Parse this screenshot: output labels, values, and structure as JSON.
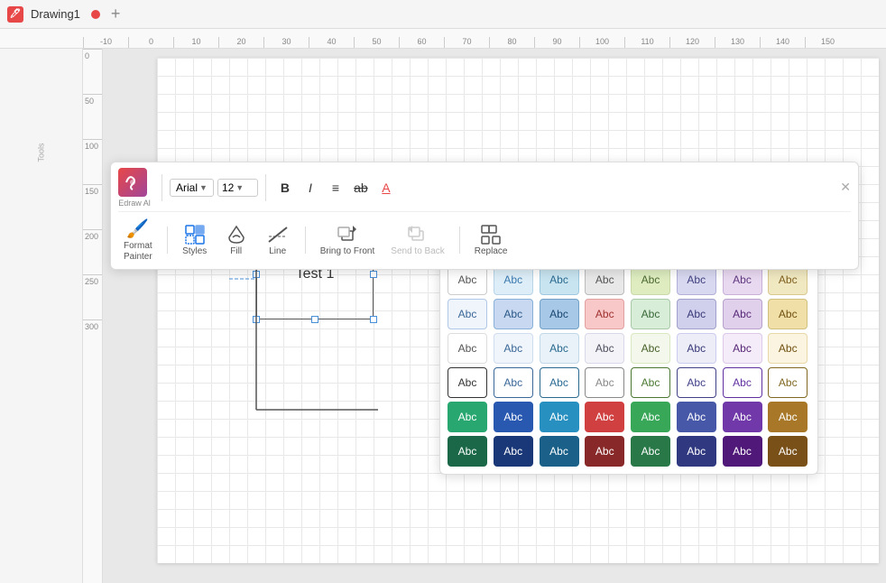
{
  "titleBar": {
    "appName": "Drawing1",
    "logoText": "🖊",
    "plusIcon": "+"
  },
  "toolbar": {
    "logoText": "n",
    "edrawLabel": "Edraw Al",
    "fontFamily": "Arial",
    "fontSize": "12",
    "boldLabel": "B",
    "italicLabel": "I",
    "alignLabel": "≡",
    "strikeLabel": "ab",
    "colorLabel": "A",
    "formatPainterLabel": "Format\nPainter",
    "stylesLabel": "Styles",
    "fillLabel": "Fill",
    "lineLabel": "Line",
    "bringFrontLabel": "Bring to Front",
    "sendBackLabel": "Send to Back",
    "replaceLabel": "Replace",
    "pinIcon": "✕"
  },
  "ruler": {
    "topMarks": [
      "-10",
      "0",
      "10",
      "20",
      "30",
      "40",
      "50",
      "60",
      "70",
      "80",
      "90",
      "100",
      "110",
      "120",
      "130",
      "140",
      "150"
    ],
    "leftMarks": [
      "0",
      "50",
      "100",
      "150",
      "200",
      "250",
      "300"
    ]
  },
  "canvas": {
    "shapeText": "Test 1"
  },
  "stylePanel": {
    "rows": [
      [
        {
          "text": "Abc",
          "bg": "",
          "border": "#ccc",
          "color": "#555"
        },
        {
          "text": "Abc",
          "bg": "#deeef8",
          "border": "#b8d4e8",
          "color": "#3a7ab0"
        },
        {
          "text": "Abc",
          "bg": "#c8e4f0",
          "border": "#9ec8e0",
          "color": "#2a6a90"
        },
        {
          "text": "Abc",
          "bg": "#e8e8e8",
          "border": "#bbb",
          "color": "#555"
        },
        {
          "text": "Abc",
          "bg": "#deecc0",
          "border": "#c8d8a8",
          "color": "#4a6830"
        },
        {
          "text": "Abc",
          "bg": "#d8d8f0",
          "border": "#b0b0d8",
          "color": "#404080"
        },
        {
          "text": "Abc",
          "bg": "#e8d8f0",
          "border": "#c8b0d8",
          "color": "#603880"
        },
        {
          "text": "Abc",
          "bg": "#f0e8c0",
          "border": "#d8c890",
          "color": "#806020"
        }
      ],
      [
        {
          "text": "Abc",
          "bg": "#f0f4fb",
          "border": "#b0c8e8",
          "color": "#3a6898"
        },
        {
          "text": "Abc",
          "bg": "#c8d8f0",
          "border": "#88b0d8",
          "color": "#2a5888"
        },
        {
          "text": "Abc",
          "bg": "#a8c8e8",
          "border": "#70a0c8",
          "color": "#1a4870"
        },
        {
          "text": "Abc",
          "bg": "#f8c8c8",
          "border": "#e0a0a0",
          "color": "#a03030"
        },
        {
          "text": "Abc",
          "bg": "#d8edd8",
          "border": "#a8c8a8",
          "color": "#386838"
        },
        {
          "text": "Abc",
          "bg": "#d0d0ec",
          "border": "#a0a0cc",
          "color": "#383878"
        },
        {
          "text": "Abc",
          "bg": "#e0d0ec",
          "border": "#b8a0cc",
          "color": "#582878"
        },
        {
          "text": "Abc",
          "bg": "#f0e0a8",
          "border": "#d0c080",
          "color": "#705010"
        }
      ],
      [
        {
          "text": "Abc",
          "bg": "",
          "border": "#ddd",
          "color": "#555"
        },
        {
          "text": "Abc",
          "bg": "#f0f4fb",
          "border": "#d0ddf0",
          "color": "#3a6898"
        },
        {
          "text": "Abc",
          "bg": "#e8f2f8",
          "border": "#c0d8e8",
          "color": "#2a6a90"
        },
        {
          "text": "Abc",
          "bg": "#f4f4f8",
          "border": "#d8d8e8",
          "color": "#505060"
        },
        {
          "text": "Abc",
          "bg": "#f4f8ec",
          "border": "#d8e8c0",
          "color": "#486028"
        },
        {
          "text": "Abc",
          "bg": "#ededf8",
          "border": "#ccccf0",
          "color": "#383878"
        },
        {
          "text": "Abc",
          "bg": "#f4ecf8",
          "border": "#dcc8e8",
          "color": "#582878"
        },
        {
          "text": "Abc",
          "bg": "#faf4e0",
          "border": "#e8d8a8",
          "color": "#705010"
        }
      ],
      [
        {
          "text": "Abc",
          "bg": "",
          "border": "#333",
          "color": "#333"
        },
        {
          "text": "Abc",
          "bg": "",
          "border": "#3a6898",
          "color": "#3a6898"
        },
        {
          "text": "Abc",
          "bg": "",
          "border": "#2a6a90",
          "color": "#2a6a90"
        },
        {
          "text": "Abc",
          "bg": "",
          "border": "#888",
          "color": "#888"
        },
        {
          "text": "Abc",
          "bg": "",
          "border": "#4a7830",
          "color": "#4a7830"
        },
        {
          "text": "Abc",
          "bg": "",
          "border": "#404088",
          "color": "#404088"
        },
        {
          "text": "Abc",
          "bg": "",
          "border": "#6030a0",
          "color": "#6030a0"
        },
        {
          "text": "Abc",
          "bg": "",
          "border": "#806820",
          "color": "#806820"
        }
      ],
      [
        {
          "text": "Abc",
          "bg": "#28a870",
          "border": "#28a870",
          "color": "white"
        },
        {
          "text": "Abc",
          "bg": "#2858b0",
          "border": "#2858b0",
          "color": "white"
        },
        {
          "text": "Abc",
          "bg": "#2890c0",
          "border": "#2890c0",
          "color": "white"
        },
        {
          "text": "Abc",
          "bg": "#d04040",
          "border": "#d04040",
          "color": "white"
        },
        {
          "text": "Abc",
          "bg": "#38a858",
          "border": "#38a858",
          "color": "white"
        },
        {
          "text": "Abc",
          "bg": "#4858a8",
          "border": "#4858a8",
          "color": "white"
        },
        {
          "text": "Abc",
          "bg": "#7038a8",
          "border": "#7038a8",
          "color": "white"
        },
        {
          "text": "Abc",
          "bg": "#a87828",
          "border": "#a87828",
          "color": "white"
        }
      ],
      [
        {
          "text": "Abc",
          "bg": "#1a6848",
          "border": "#1a6848",
          "color": "white"
        },
        {
          "text": "Abc",
          "bg": "#1a3878",
          "border": "#1a3878",
          "color": "white"
        },
        {
          "text": "Abc",
          "bg": "#1a6088",
          "border": "#1a6088",
          "color": "white"
        },
        {
          "text": "Abc",
          "bg": "#882828",
          "border": "#882828",
          "color": "white"
        },
        {
          "text": "Abc",
          "bg": "#287848",
          "border": "#287848",
          "color": "white"
        },
        {
          "text": "Abc",
          "bg": "#303880",
          "border": "#303880",
          "color": "white"
        },
        {
          "text": "Abc",
          "bg": "#501878",
          "border": "#501878",
          "color": "white"
        },
        {
          "text": "Abc",
          "bg": "#785018",
          "border": "#785018",
          "color": "white"
        }
      ]
    ]
  }
}
